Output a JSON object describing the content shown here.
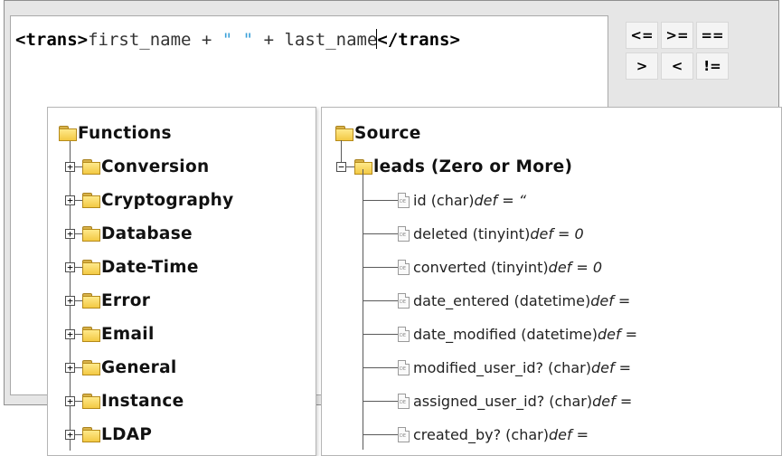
{
  "editor": {
    "open_tag": "<trans>",
    "expr_a": "first_name + ",
    "string_literal": "\" \"",
    "expr_b": " + last_name",
    "close_tag": "</trans>"
  },
  "operators": [
    {
      "label": "<="
    },
    {
      "label": ">="
    },
    {
      "label": "=="
    },
    {
      "label": ">"
    },
    {
      "label": "<"
    },
    {
      "label": "!="
    }
  ],
  "functions_tree": {
    "root_label": "Functions",
    "items": [
      {
        "label": "Conversion"
      },
      {
        "label": "Cryptography"
      },
      {
        "label": "Database"
      },
      {
        "label": "Date-Time"
      },
      {
        "label": "Error"
      },
      {
        "label": "Email"
      },
      {
        "label": "General"
      },
      {
        "label": "Instance"
      },
      {
        "label": "LDAP"
      }
    ]
  },
  "source_tree": {
    "root_label": "Source",
    "node_label": "leads (Zero or More)",
    "doc_icon_text": "DE",
    "fields": [
      {
        "name": "id (char) ",
        "def": "def = “"
      },
      {
        "name": "deleted (tinyint) ",
        "def": "def = 0"
      },
      {
        "name": "converted (tinyint) ",
        "def": "def = 0"
      },
      {
        "name": "date_entered (datetime) ",
        "def": "def ="
      },
      {
        "name": "date_modified (datetime) ",
        "def": "def ="
      },
      {
        "name": "modified_user_id? (char) ",
        "def": "def ="
      },
      {
        "name": "assigned_user_id? (char) ",
        "def": "def ="
      },
      {
        "name": "created_by? (char) ",
        "def": "def ="
      }
    ]
  }
}
